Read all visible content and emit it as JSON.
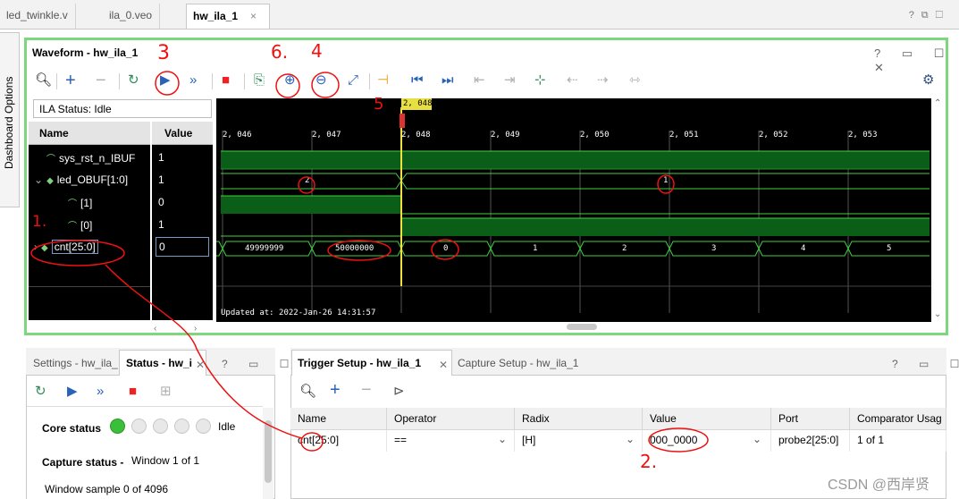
{
  "file_tabs": [
    {
      "label": "led_twinkle.v"
    },
    {
      "label": "ila_0.veo"
    },
    {
      "label": "hw_ila_1",
      "close": "×"
    }
  ],
  "waveform": {
    "title": "Waveform - hw_ila_1",
    "window_icons": "? ▭ ☐ ✕",
    "ila_status": "ILA Status:  Idle",
    "name_header": "Name",
    "value_header": "Value",
    "signals": [
      {
        "name": "sys_rst_n_IBUF",
        "value": "1"
      },
      {
        "name": "led_OBUF[1:0]",
        "value": "1"
      },
      {
        "name": "[1]",
        "value": "0"
      },
      {
        "name": "[0]",
        "value": "1"
      },
      {
        "name": "cnt[25:0]",
        "value": "0"
      }
    ],
    "cursor_label": "2, 048",
    "time_ticks": [
      "2, 046",
      "2, 047",
      "2, 048",
      "2, 049",
      "2, 050",
      "2, 051",
      "2, 052",
      "2, 053"
    ],
    "led_values": [
      "2",
      "1"
    ],
    "cnt_values": [
      "49999999",
      "50000000",
      "0",
      "1",
      "2",
      "3",
      "4",
      "5"
    ],
    "updated": "Updated at: 2022-Jan-26 14:31:57"
  },
  "dashboard_label": "Dashboard Options",
  "settings_panel": {
    "tab1": "Settings - hw_ila_",
    "tab2": "Status - hw_i",
    "close": "✕",
    "window_icons": "? ▭ ☐",
    "core_status_label": "Core status",
    "core_status_value": "Idle",
    "capture_status_label": "Capture status -",
    "capture_status_value": "Window 1 of 1",
    "window_sample": "Window sample 0 of 4096"
  },
  "trigger_panel": {
    "tab1": "Trigger Setup - hw_ila_1",
    "close": "✕",
    "tab2": "Capture Setup - hw_ila_1",
    "window_icons": "? ▭ ☐",
    "columns": [
      "Name",
      "Operator",
      "Radix",
      "Value",
      "Port",
      "Comparator Usag"
    ],
    "row": {
      "name": "cnt[25:0]",
      "operator": "==",
      "radix": "[H]",
      "value": "000_0000",
      "port": "probe2[25:0]",
      "comparator": "1 of 1"
    }
  },
  "annotations": [
    "1.",
    "2.",
    "3",
    "5",
    "6.",
    "4"
  ],
  "watermark": "CSDN @西岸贤"
}
